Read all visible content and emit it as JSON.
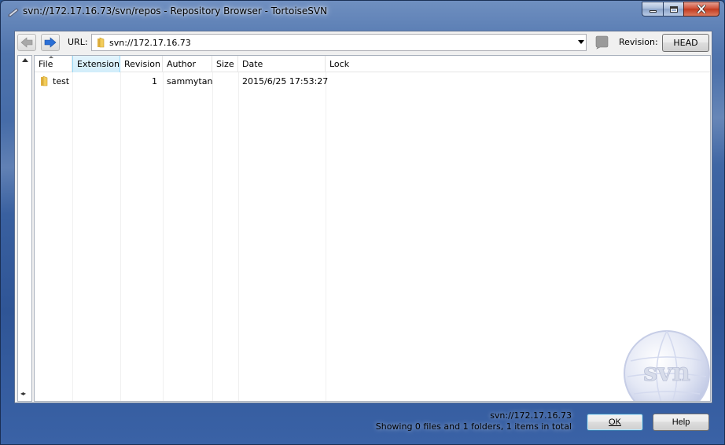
{
  "window": {
    "title": "svn://172.17.16.73/svn/repos - Repository Browser - TortoiseSVN"
  },
  "toolbar": {
    "url_label": "URL:",
    "url_value": "svn://172.17.16.73",
    "revision_label": "Revision:",
    "revision_button": "HEAD"
  },
  "list": {
    "columns": [
      "File",
      "Extension",
      "Revision",
      "Author",
      "Size",
      "Date",
      "Lock"
    ],
    "sorted_column": "File",
    "rows": [
      {
        "file": "test",
        "extension": "",
        "revision": "1",
        "author": "sammytan",
        "size": "",
        "date": "2015/6/25 17:53:27",
        "lock": ""
      }
    ]
  },
  "watermark": {
    "text": "svn"
  },
  "status": {
    "url": "svn://172.17.16.73",
    "summary": "Showing 0 files and 1 folders, 1 items in total"
  },
  "buttons": {
    "ok": "OK",
    "help": "Help"
  },
  "colors": {
    "frame": "#3d64a3",
    "client_bg": "#f0f0f0",
    "header_selected": "#d2edfa",
    "close_button": "#c23a1f"
  }
}
